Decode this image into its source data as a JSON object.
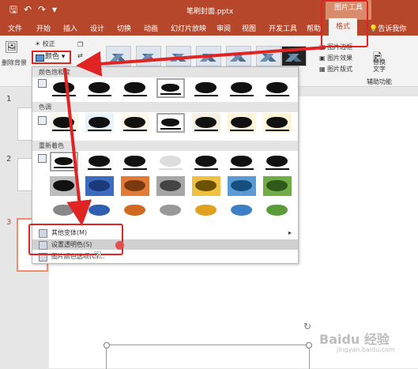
{
  "window": {
    "title": "笔刷封面.pptx",
    "context_tab_group": "图片工具"
  },
  "quick_access": {
    "save_icon": "save-icon",
    "undo_icon": "undo-icon",
    "redo_icon": "redo-icon",
    "customize_icon": "customize-icon"
  },
  "tabs": [
    "文件",
    "开始",
    "插入",
    "设计",
    "切换",
    "动画",
    "幻灯片放映",
    "审阅",
    "视图",
    "开发工具",
    "帮助"
  ],
  "active_tab": "格式",
  "tell_me": "告诉我你",
  "ribbon": {
    "remove_bg": "删除背景",
    "correct": "校正",
    "color": "颜色",
    "picture_border": "图片边框",
    "picture_effects": "图片效果",
    "picture_layout": "图片版式",
    "alt_text": "替换文字",
    "accessibility": "辅助功能"
  },
  "color_menu": {
    "sections": [
      "颜色饱和度",
      "色调",
      "重新着色"
    ],
    "items": [
      {
        "label": "其他变体(M)",
        "has_submenu": true
      },
      {
        "label": "设置透明色(S)",
        "highlighted": true
      },
      {
        "label": "图片颜色选项(C)..."
      }
    ]
  },
  "slides": {
    "numbers": [
      "1",
      "2",
      "3"
    ],
    "selected": "3"
  },
  "watermark": {
    "brand": "Baidu 经验",
    "sub": "jingyan.baidu.com"
  },
  "colors": {
    "accent": "#b7472a",
    "highlight_box": "#e02424"
  }
}
